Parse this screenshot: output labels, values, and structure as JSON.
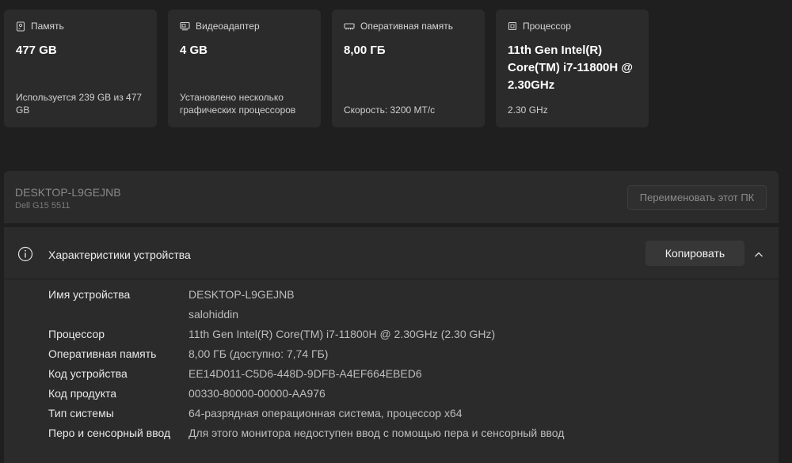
{
  "cards": [
    {
      "icon": "storage-icon",
      "title": "Память",
      "value": "477 GB",
      "footer": "Используется 239 GB из 477 GB"
    },
    {
      "icon": "display-adapter-icon",
      "title": "Видеоадаптер",
      "value": "4 GB",
      "footer": "Установлено несколько графических процессоров"
    },
    {
      "icon": "ram-icon",
      "title": "Оперативная память",
      "value": "8,00 ГБ",
      "footer": "Скорость: 3200 MT/с"
    },
    {
      "icon": "processor-icon",
      "title": "Процессор",
      "value": "11th Gen Intel(R) Core(TM) i7-11800H @ 2.30GHz",
      "footer": "2.30 GHz"
    }
  ],
  "device": {
    "name": "DESKTOP-L9GEJNB",
    "model": "Dell G15 5511",
    "rename_label": "Переименовать этот ПК"
  },
  "specs": {
    "title": "Характеристики устройства",
    "copy_label": "Копировать",
    "rows": [
      {
        "label": "Имя устройства",
        "value": "DESKTOP-L9GEJNB"
      },
      {
        "label": "",
        "value": "salohiddin"
      },
      {
        "label": "Процессор",
        "value": "11th Gen Intel(R) Core(TM) i7-11800H @ 2.30GHz (2.30 GHz)"
      },
      {
        "label": "Оперативная память",
        "value": "8,00 ГБ (доступно: 7,74 ГБ)"
      },
      {
        "label": "Код устройства",
        "value": "EE14D011-C5D6-448D-9DFB-A4EF664EBED6"
      },
      {
        "label": "Код продукта",
        "value": "00330-80000-00000-AA976"
      },
      {
        "label": "Тип системы",
        "value": "64-разрядная операционная система, процессор x64"
      },
      {
        "label": "Перо и сенсорный ввод",
        "value": "Для этого монитора недоступен ввод с помощью пера и сенсорный ввод"
      }
    ]
  }
}
